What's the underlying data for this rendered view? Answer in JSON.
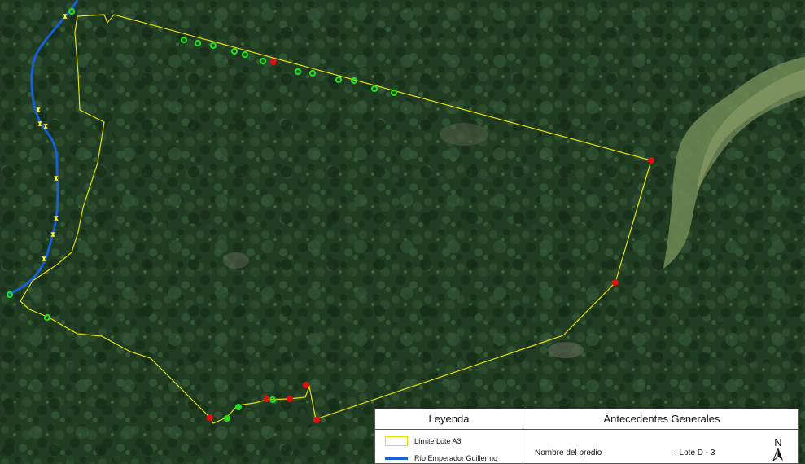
{
  "legend": {
    "title": "Leyenda",
    "items": [
      {
        "label": "Límite Lote A3",
        "kind": "boundary",
        "color": "#e8e000"
      },
      {
        "label": "Río Emperador Guillermo",
        "kind": "river",
        "color": "#1560d8"
      }
    ]
  },
  "info": {
    "title": "Antecedentes Generales",
    "property_label": "Nombre del predio",
    "property_value": ": Lote D - 3"
  },
  "north_arrow": "N",
  "colors": {
    "boundary": "#e8e000",
    "river": "#1560d8",
    "point_green": "#22dd22",
    "point_red": "#e01010",
    "marker_yellow": "#ffff22",
    "forest": "#1f3a22"
  }
}
